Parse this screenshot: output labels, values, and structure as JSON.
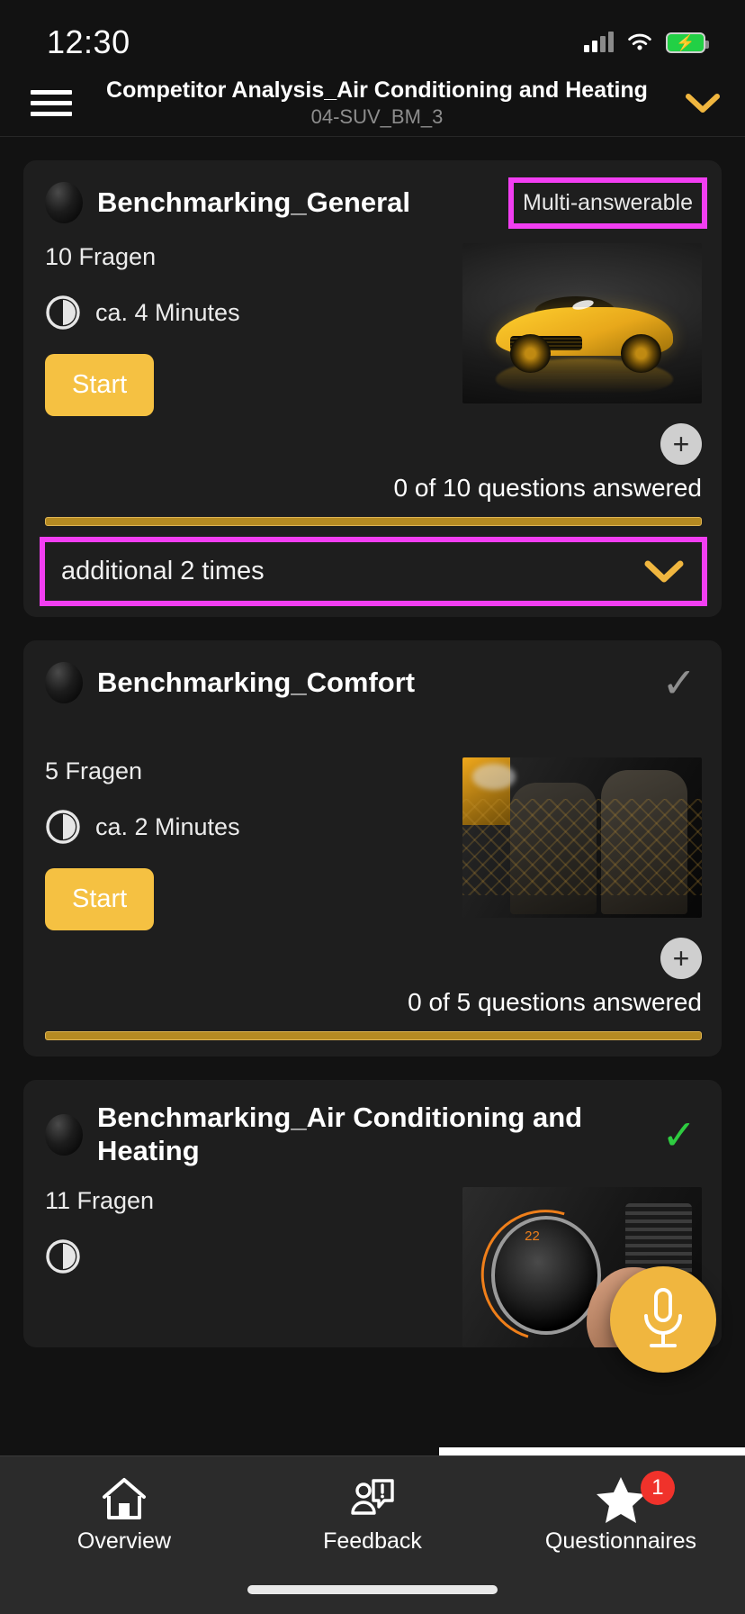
{
  "status_bar": {
    "time": "12:30",
    "signal_icon": "cellular-signal-icon",
    "wifi_icon": "wifi-icon",
    "battery_icon": "battery-charging-icon"
  },
  "header": {
    "menu_icon": "hamburger-menu-icon",
    "title": "Competitor Analysis_Air Conditioning and Heating",
    "subtitle": "04-SUV_BM_3",
    "chevron_icon": "chevron-down-icon",
    "accent_color": "#f0b63f"
  },
  "cards": [
    {
      "title": "Benchmarking_General",
      "badge": "Multi-answerable",
      "badge_highlighted": true,
      "status_icon": "none",
      "questions": "10 Fragen",
      "duration": "ca. 4 Minutes",
      "start_label": "Start",
      "add_label": "+",
      "answered": "0 of 10 questions answered",
      "thumb": "yellow-sports-car-photo",
      "expander": {
        "label": "additional 2 times",
        "chevron_icon": "chevron-down-icon",
        "highlighted": true
      }
    },
    {
      "title": "Benchmarking_Comfort",
      "badge": "",
      "badge_highlighted": false,
      "status_icon": "check-grey",
      "questions": "5 Fragen",
      "duration": "ca. 2 Minutes",
      "start_label": "Start",
      "add_label": "+",
      "answered": "0 of 5 questions answered",
      "thumb": "car-seats-photo",
      "expander": null
    },
    {
      "title": "Benchmarking_Air Conditioning and Heating",
      "badge": "",
      "badge_highlighted": false,
      "status_icon": "check-green",
      "questions": "11 Fragen",
      "duration": "",
      "start_label": "",
      "add_label": "",
      "answered": "",
      "thumb": "ac-control-knob-photo",
      "expander": null
    }
  ],
  "fab": {
    "icon": "microphone-icon",
    "color": "#f0b63f"
  },
  "tabbar": {
    "items": [
      {
        "label": "Overview",
        "icon": "home-icon",
        "badge": ""
      },
      {
        "label": "Feedback",
        "icon": "person-comment-icon",
        "badge": ""
      },
      {
        "label": "Questionnaires",
        "icon": "star-icon",
        "badge": "1"
      }
    ],
    "badge_color": "#f0322b"
  },
  "colors": {
    "accent": "#f0b63f",
    "start_button": "#f5c142",
    "divider_gold": "#b58a22",
    "highlight_magenta": "#f23ef2",
    "check_green": "#2ecc40",
    "card_bg": "#1e1e1e",
    "page_bg": "#121212"
  }
}
